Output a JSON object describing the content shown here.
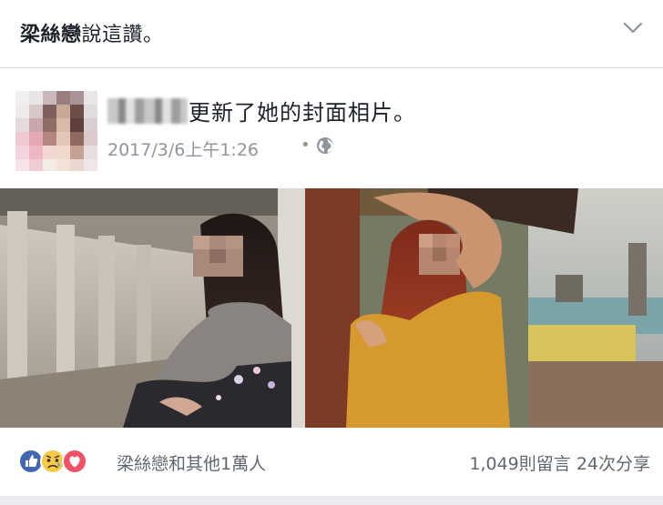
{
  "story_header": {
    "friend_name": "梁絲戀",
    "action": "說這讚。"
  },
  "post": {
    "action_text": "更新了她的封面相片。",
    "timestamp": "2017/3/6上午1:26",
    "separator": "•"
  },
  "reactions": {
    "icons": [
      "like-icon",
      "sad-icon",
      "love-icon"
    ],
    "summary": "梁絲戀和其他1萬人",
    "comments": "1,049則留言",
    "shares": "24次分享"
  },
  "colors": {
    "like_blue": "#4267b2",
    "love_red": "#f25268",
    "sad_yellow": "#f7c948",
    "text_gray": "#606770"
  }
}
